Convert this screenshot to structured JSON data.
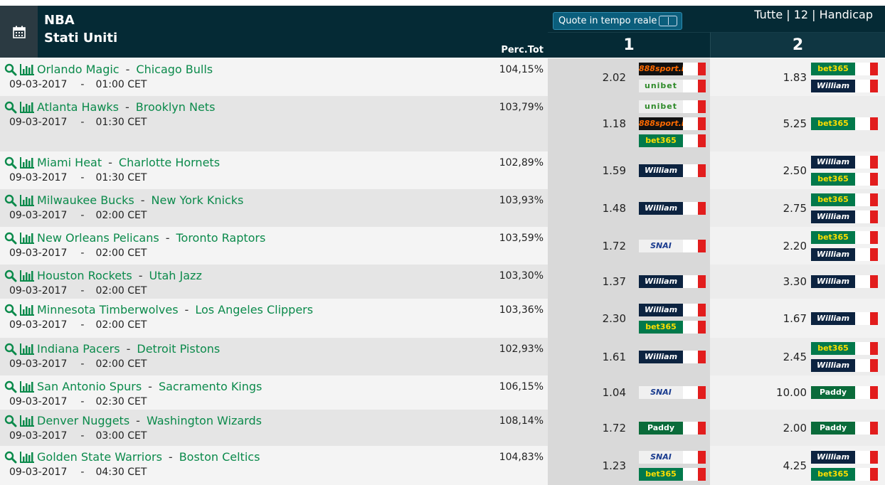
{
  "header": {
    "league": "NBA",
    "country": "Stati Uniti",
    "perc_label": "Perc.Tot",
    "quote_button": "Quote in tempo reale",
    "filters": "Tutte | 12 | Handicap",
    "col1": "1",
    "col2": "2"
  },
  "rows": [
    {
      "home": "Orlando Magic",
      "away": "Chicago Bulls",
      "date": "09-03-2017",
      "time": "01:00 CET",
      "perc": "104,15%",
      "odd1": "2.02",
      "odd2": "1.83",
      "bk1": [
        "888sport.it",
        "unibet"
      ],
      "bk2": [
        "bet365",
        "William HILL"
      ]
    },
    {
      "home": "Atlanta Hawks",
      "away": "Brooklyn Nets",
      "date": "09-03-2017",
      "time": "01:30 CET",
      "perc": "103,79%",
      "odd1": "1.18",
      "odd2": "5.25",
      "bk1": [
        "unibet",
        "888sport.it",
        "bet365"
      ],
      "bk2": [
        "bet365"
      ]
    },
    {
      "home": "Miami Heat",
      "away": "Charlotte Hornets",
      "date": "09-03-2017",
      "time": "01:30 CET",
      "perc": "102,89%",
      "odd1": "1.59",
      "odd2": "2.50",
      "bk1": [
        "William HILL"
      ],
      "bk2": [
        "William HILL",
        "bet365"
      ]
    },
    {
      "home": "Milwaukee Bucks",
      "away": "New York Knicks",
      "date": "09-03-2017",
      "time": "02:00 CET",
      "perc": "103,93%",
      "odd1": "1.48",
      "odd2": "2.75",
      "bk1": [
        "William HILL"
      ],
      "bk2": [
        "bet365",
        "William HILL"
      ]
    },
    {
      "home": "New Orleans Pelicans",
      "away": "Toronto Raptors",
      "date": "09-03-2017",
      "time": "02:00 CET",
      "perc": "103,59%",
      "odd1": "1.72",
      "odd2": "2.20",
      "bk1": [
        "SNAI"
      ],
      "bk2": [
        "bet365",
        "William HILL"
      ]
    },
    {
      "home": "Houston Rockets",
      "away": "Utah Jazz",
      "date": "09-03-2017",
      "time": "02:00 CET",
      "perc": "103,30%",
      "odd1": "1.37",
      "odd2": "3.30",
      "bk1": [
        "William HILL"
      ],
      "bk2": [
        "William HILL"
      ]
    },
    {
      "home": "Minnesota Timberwolves",
      "away": "Los Angeles Clippers",
      "date": "09-03-2017",
      "time": "02:00 CET",
      "perc": "103,36%",
      "odd1": "2.30",
      "odd2": "1.67",
      "bk1": [
        "William HILL",
        "bet365"
      ],
      "bk2": [
        "William HILL"
      ]
    },
    {
      "home": "Indiana Pacers",
      "away": "Detroit Pistons",
      "date": "09-03-2017",
      "time": "02:00 CET",
      "perc": "102,93%",
      "odd1": "1.61",
      "odd2": "2.45",
      "bk1": [
        "William HILL"
      ],
      "bk2": [
        "bet365",
        "William HILL"
      ]
    },
    {
      "home": "San Antonio Spurs",
      "away": "Sacramento Kings",
      "date": "09-03-2017",
      "time": "02:30 CET",
      "perc": "106,15%",
      "odd1": "1.04",
      "odd2": "10.00",
      "bk1": [
        "SNAI"
      ],
      "bk2": [
        "Paddy Power"
      ]
    },
    {
      "home": "Denver Nuggets",
      "away": "Washington Wizards",
      "date": "09-03-2017",
      "time": "03:00 CET",
      "perc": "108,14%",
      "odd1": "1.72",
      "odd2": "2.00",
      "bk1": [
        "Paddy Power"
      ],
      "bk2": [
        "Paddy Power"
      ]
    },
    {
      "home": "Golden State Warriors",
      "away": "Boston Celtics",
      "date": "09-03-2017",
      "time": "04:30 CET",
      "perc": "104,83%",
      "odd1": "1.23",
      "odd2": "4.25",
      "bk1": [
        "SNAI",
        "bet365"
      ],
      "bk2": [
        "William HILL",
        "bet365"
      ]
    }
  ],
  "colors": {
    "header_bg": "#052a35",
    "team": "#0b8a4b",
    "icon": "#0b8a4b"
  },
  "icons": {
    "calendar": "calendar-icon",
    "search": "search-icon",
    "stats": "bar-chart-icon",
    "toggle": "toggle-icon"
  }
}
